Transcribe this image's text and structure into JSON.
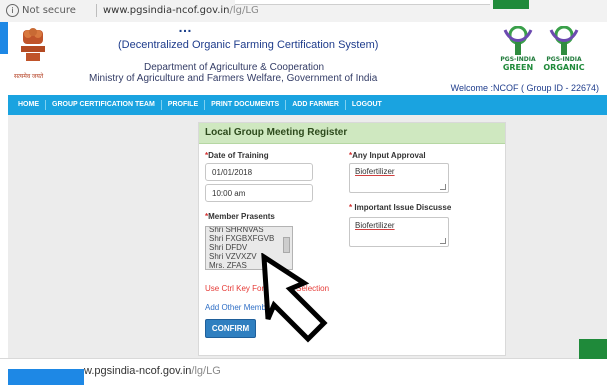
{
  "browser": {
    "security_label": "Not secure",
    "info_icon": "info-icon",
    "url_host": "www.pgsindia-ncof.gov.in",
    "url_path": "/lg/LG"
  },
  "header": {
    "title_fragment": "…",
    "subtitle": "(Decentralized Organic Farming Certification System)",
    "dept": "Department of Agriculture & Cooperation",
    "ministry": "Ministry of Agriculture and Farmers Welfare, Government of India",
    "emblem_caption": "सत्यमेव जयते",
    "welcome": "Welcome :NCOF ( Group ID - 22674)",
    "logos": [
      {
        "line1": "PGS-INDIA",
        "line2": "GREEN"
      },
      {
        "line1": "PGS-INDIA",
        "line2": "ORGANIC"
      }
    ]
  },
  "nav": {
    "items": [
      "HOME",
      "GROUP CERTIFICATION TEAM",
      "PROFILE",
      "PRINT DOCUMENTS",
      "ADD FARMER",
      "LOGOUT"
    ]
  },
  "form": {
    "title": "Local Group Meeting Register",
    "date_label": "Date of Training",
    "date_value": "01/01/2018",
    "time_value": "10:00 am",
    "members_label": "Member Prasents",
    "members": [
      "Shri SHRNVAS",
      "Shri FXGBXFGVB",
      "Shri DFDV",
      "Shri VZVXZV",
      "Mrs. ZFAS"
    ],
    "ctrl_hint": "Use Ctrl Key For Multiple Selection",
    "add_other": "Add Other Members",
    "confirm": "CONFIRM",
    "input_approval_label": "Any Input Approval",
    "input_approval_value": "Biofertilizer",
    "issue_label": "Important Issue Discusse",
    "issue_value": "Biofertilizer",
    "required_marker": "*"
  },
  "statusbar": {
    "url_host": "w.pgsindia-ncof.gov.in",
    "url_path": "/lg/LG"
  },
  "colors": {
    "nav": "#1aa3e0",
    "panel_header": "#cfe8c0",
    "confirm": "#2f7fc0",
    "required": "#d32f2f"
  }
}
